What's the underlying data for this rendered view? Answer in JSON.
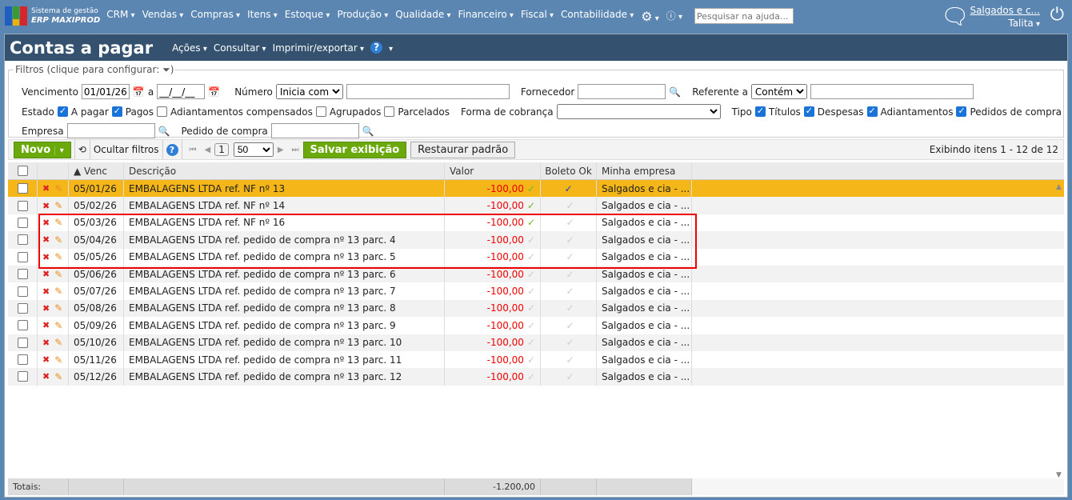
{
  "app": {
    "subtitle": "Sistema de gestão",
    "name": "ERP MAXIPROD"
  },
  "menu": [
    "CRM",
    "Vendas",
    "Compras",
    "Itens",
    "Estoque",
    "Produção",
    "Qualidade",
    "Financeiro",
    "Fiscal",
    "Contabilidade"
  ],
  "help_placeholder": "Pesquisar na ajuda...",
  "user": {
    "company": "Salgados e c...",
    "name": "Talita"
  },
  "page": {
    "title": "Contas a pagar",
    "actions": [
      "Ações",
      "Consultar",
      "Imprimir/exportar"
    ]
  },
  "filters": {
    "legend": "Filtros (clique para configurar:",
    "vencimento_label": "Vencimento",
    "venc_from": "01/01/26",
    "venc_sep": "a",
    "venc_to": "__/__/__",
    "numero_label": "Número",
    "numero_op": "Inicia com",
    "fornecedor_label": "Fornecedor",
    "referente_label": "Referente a",
    "referente_op": "Contém",
    "estado_label": "Estado",
    "estados": [
      {
        "label": "A pagar",
        "on": true
      },
      {
        "label": "Pagos",
        "on": true
      },
      {
        "label": "Adiantamentos compensados",
        "on": false
      },
      {
        "label": "Agrupados",
        "on": false
      },
      {
        "label": "Parcelados",
        "on": false
      }
    ],
    "cobranca_label": "Forma de cobrança",
    "tipo_label": "Tipo",
    "tipos": [
      {
        "label": "Títulos",
        "on": true
      },
      {
        "label": "Despesas",
        "on": true
      },
      {
        "label": "Adiantamentos",
        "on": true
      },
      {
        "label": "Pedidos de compra",
        "on": true
      }
    ],
    "empresa_label": "Empresa",
    "pedido_label": "Pedido de compra"
  },
  "toolbar": {
    "novo": "Novo",
    "ocultar": "Ocultar filtros",
    "page": "1",
    "per_page": "50",
    "salvar": "Salvar exibição",
    "restaurar": "Restaurar padrão",
    "status": "Exibindo itens 1 - 12 de 12"
  },
  "columns": [
    "Venc",
    "Descrição",
    "Valor",
    "Boleto Ok",
    "Minha empresa"
  ],
  "rows": [
    {
      "venc": "05/01/26",
      "desc": "EMBALAGENS LTDA ref. NF nº 13",
      "valor": "-100,00",
      "paid": true,
      "boleto": true,
      "empresa": "Salgados e cia - ..."
    },
    {
      "venc": "05/02/26",
      "desc": "EMBALAGENS LTDA ref. NF nº 14",
      "valor": "-100,00",
      "paid": true,
      "boleto": false,
      "empresa": "Salgados e cia - ..."
    },
    {
      "venc": "05/03/26",
      "desc": "EMBALAGENS LTDA ref. NF nº 16",
      "valor": "-100,00",
      "paid": true,
      "boleto": false,
      "empresa": "Salgados e cia - ..."
    },
    {
      "venc": "05/04/26",
      "desc": "EMBALAGENS LTDA ref. pedido de compra nº 13 parc. 4",
      "valor": "-100,00",
      "paid": false,
      "boleto": false,
      "empresa": "Salgados e cia - ..."
    },
    {
      "venc": "05/05/26",
      "desc": "EMBALAGENS LTDA ref. pedido de compra nº 13 parc. 5",
      "valor": "-100,00",
      "paid": false,
      "boleto": false,
      "empresa": "Salgados e cia - ..."
    },
    {
      "venc": "05/06/26",
      "desc": "EMBALAGENS LTDA ref. pedido de compra nº 13 parc. 6",
      "valor": "-100,00",
      "paid": false,
      "boleto": false,
      "empresa": "Salgados e cia - ..."
    },
    {
      "venc": "05/07/26",
      "desc": "EMBALAGENS LTDA ref. pedido de compra nº 13 parc. 7",
      "valor": "-100,00",
      "paid": false,
      "boleto": false,
      "empresa": "Salgados e cia - ..."
    },
    {
      "venc": "05/08/26",
      "desc": "EMBALAGENS LTDA ref. pedido de compra nº 13 parc. 8",
      "valor": "-100,00",
      "paid": false,
      "boleto": false,
      "empresa": "Salgados e cia - ..."
    },
    {
      "venc": "05/09/26",
      "desc": "EMBALAGENS LTDA ref. pedido de compra nº 13 parc. 9",
      "valor": "-100,00",
      "paid": false,
      "boleto": false,
      "empresa": "Salgados e cia - ..."
    },
    {
      "venc": "05/10/26",
      "desc": "EMBALAGENS LTDA ref. pedido de compra nº 13 parc. 10",
      "valor": "-100,00",
      "paid": false,
      "boleto": false,
      "empresa": "Salgados e cia - ..."
    },
    {
      "venc": "05/11/26",
      "desc": "EMBALAGENS LTDA ref. pedido de compra nº 13 parc. 11",
      "valor": "-100,00",
      "paid": false,
      "boleto": false,
      "empresa": "Salgados e cia - ..."
    },
    {
      "venc": "05/12/26",
      "desc": "EMBALAGENS LTDA ref. pedido de compra nº 13 parc. 12",
      "valor": "-100,00",
      "paid": false,
      "boleto": false,
      "empresa": "Salgados e cia - ..."
    }
  ],
  "totals": {
    "label": "Totais:",
    "valor": "-1.200,00"
  }
}
